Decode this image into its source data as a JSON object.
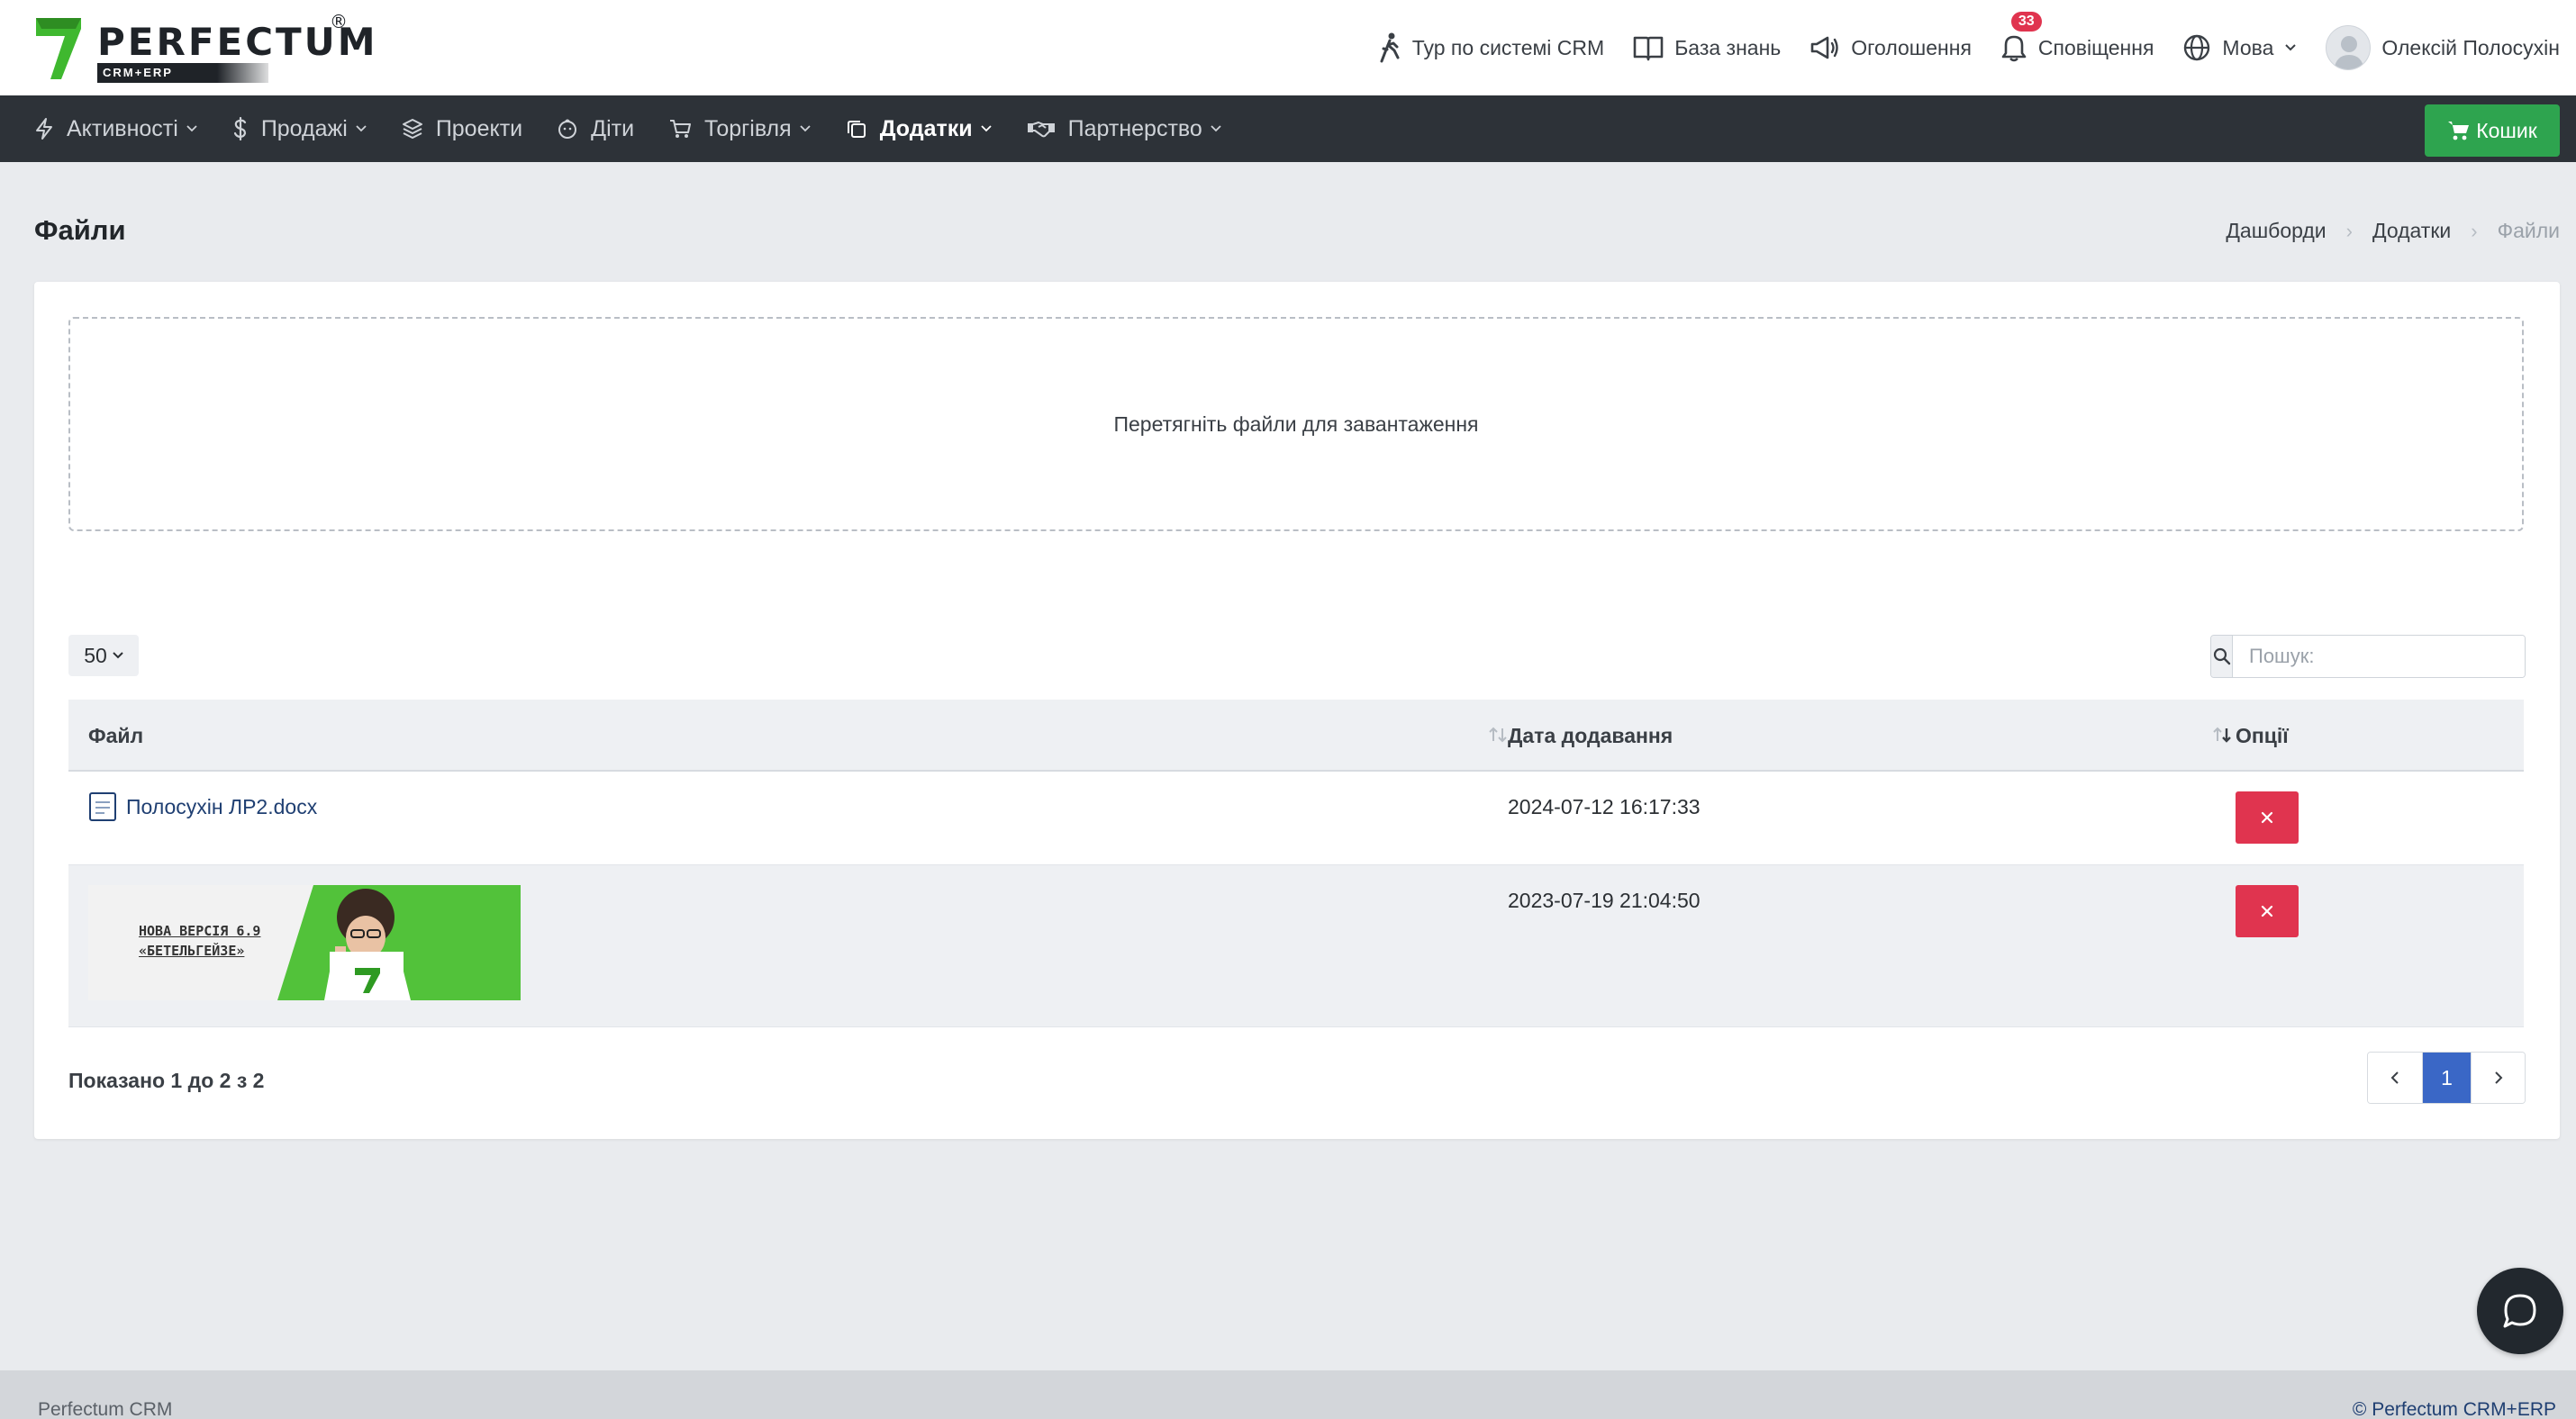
{
  "brand": {
    "name": "PERFECTUM",
    "sub": "CRM+ERP",
    "reg": "®"
  },
  "header": {
    "tour": "Тур по системі CRM",
    "knowledge": "База знань",
    "announcements": "Оголошення",
    "notifications": "Сповіщення",
    "notifications_count": "33",
    "language": "Мова",
    "user_name": "Олексій Полосухін"
  },
  "nav": {
    "items": [
      {
        "label": "Активності",
        "icon": "bolt-icon",
        "dropdown": true
      },
      {
        "label": "Продажі",
        "icon": "dollar-icon",
        "dropdown": true
      },
      {
        "label": "Проекти",
        "icon": "layers-icon",
        "dropdown": false
      },
      {
        "label": "Діти",
        "icon": "baby-icon",
        "dropdown": false
      },
      {
        "label": "Торгівля",
        "icon": "cart-icon",
        "dropdown": true
      },
      {
        "label": "Додатки",
        "icon": "copy-icon",
        "dropdown": true,
        "active": true
      },
      {
        "label": "Партнерство",
        "icon": "handshake-icon",
        "dropdown": true
      }
    ],
    "cart_button": "Кошик"
  },
  "page": {
    "title": "Файли",
    "breadcrumb": [
      "Дашборди",
      "Додатки",
      "Файли"
    ]
  },
  "dropzone": {
    "text": "Перетягніть файли для завантаження"
  },
  "table_controls": {
    "page_length": "50",
    "search_placeholder": "Пошук:"
  },
  "table": {
    "columns": [
      "Файл",
      "Дата додавання",
      "Опції"
    ],
    "rows": [
      {
        "file": "Полосухін ЛР2.docx",
        "type": "document",
        "date": "2024-07-12 16:17:33"
      },
      {
        "file": "",
        "type": "image",
        "image_text_1": "НОВА ВЕРСІЯ 6.9",
        "image_text_2": "«БЕТЕЛЬГЕЙЗЕ»",
        "date": "2023-07-19 21:04:50"
      }
    ]
  },
  "pagination": {
    "info": "Показано 1 до 2 з 2",
    "current_page": "1"
  },
  "footer": {
    "left": "Perfectum CRM",
    "right": "© Perfectum CRM+ERP"
  },
  "colors": {
    "nav_bg": "#2d3238",
    "cart_green": "#2ea44f",
    "delete_red": "#e0344f",
    "page_active": "#3a67c6",
    "brand_green": "#3fb82f"
  }
}
